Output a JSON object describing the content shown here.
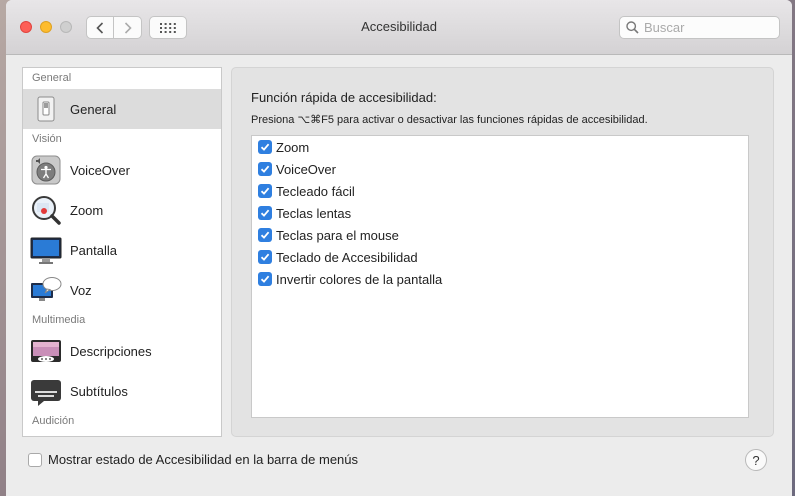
{
  "window": {
    "title": "Accesibilidad",
    "search_placeholder": "Buscar"
  },
  "sidebar": {
    "categories": [
      "General",
      "Visión",
      "Multimedia",
      "Audición"
    ],
    "items": [
      {
        "label": "General",
        "icon": "switch-icon",
        "selected": true
      },
      {
        "label": "VoiceOver",
        "icon": "voiceover-icon"
      },
      {
        "label": "Zoom",
        "icon": "magnifier-icon"
      },
      {
        "label": "Pantalla",
        "icon": "display-icon"
      },
      {
        "label": "Voz",
        "icon": "speech-icon"
      },
      {
        "label": "Descripciones",
        "icon": "descriptions-icon"
      },
      {
        "label": "Subtítulos",
        "icon": "captions-icon"
      }
    ]
  },
  "main": {
    "heading": "Función rápida de accesibilidad:",
    "description": "Presiona ⌥⌘F5 para activar o desactivar las funciones rápidas de accesibilidad.",
    "options": [
      {
        "label": "Zoom",
        "checked": true
      },
      {
        "label": "VoiceOver",
        "checked": true
      },
      {
        "label": "Tecleado fácil",
        "checked": true
      },
      {
        "label": "Teclas lentas",
        "checked": true
      },
      {
        "label": "Teclas para el mouse",
        "checked": true
      },
      {
        "label": "Teclado de Accesibilidad",
        "checked": true
      },
      {
        "label": "Invertir colores de la pantalla",
        "checked": true
      }
    ]
  },
  "footer": {
    "show_status_label": "Mostrar estado de Accesibilidad en la barra de menús",
    "show_status_checked": false,
    "help_label": "?"
  },
  "colors": {
    "checkbox_accent": "#2f7fe0",
    "selected_row": "#dcdcdc",
    "close": "#fd5f57",
    "minimize": "#fdbc2e"
  }
}
